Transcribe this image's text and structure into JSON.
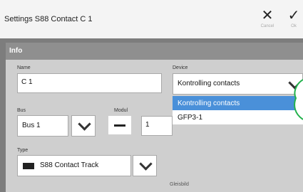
{
  "window": {
    "title": "Settings S88 Contact C 1"
  },
  "toolbar": {
    "cancel_icon": "close-icon",
    "cancel_label": "Cancel",
    "ok_icon": "check-icon",
    "ok_label": "Ok"
  },
  "section": {
    "title": "Info"
  },
  "name_field": {
    "label": "Name",
    "value": "C 1"
  },
  "device": {
    "label": "Device",
    "selected": "Kontrolling contacts",
    "options": [
      "Kontrolling contacts",
      "GFP3-1"
    ]
  },
  "bus": {
    "label": "Bus",
    "selected": "Bus 1"
  },
  "modul": {
    "label": "Modul",
    "value": "1"
  },
  "type": {
    "label": "Type",
    "selected": "S88 Contact Track",
    "icon": "track-icon"
  },
  "footer": {
    "gleisbild_label": "Gleisbild"
  },
  "colors": {
    "highlight": "#4a90d9",
    "header_bar": "#8f8f8f",
    "panel": "#cfcfcf"
  }
}
